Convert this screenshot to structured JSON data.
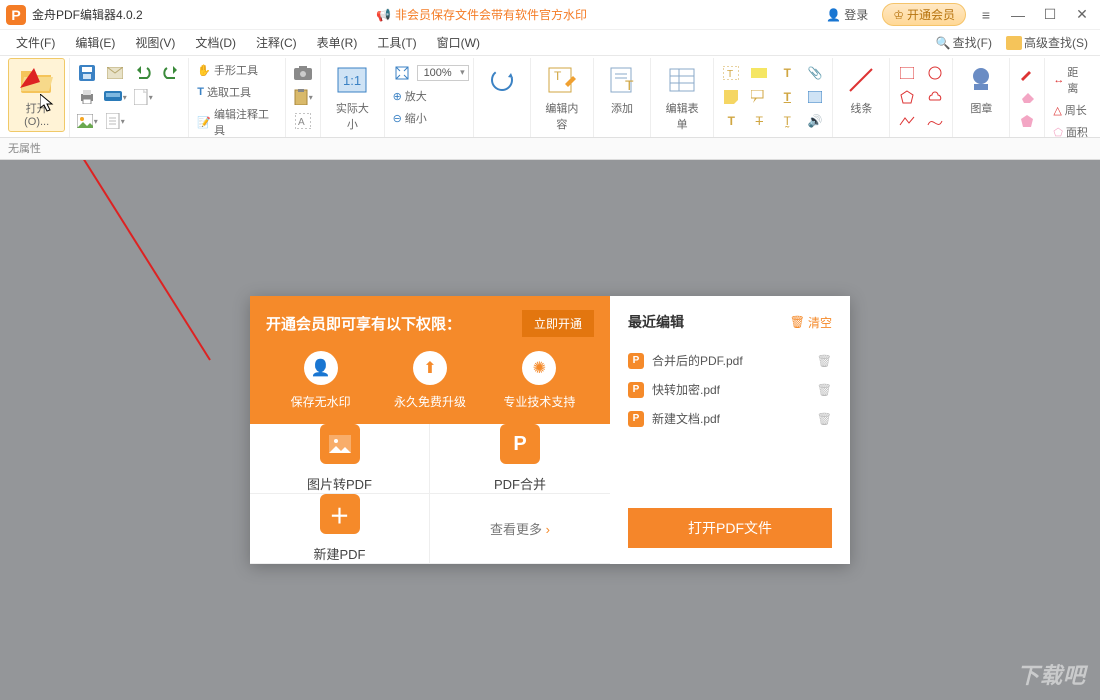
{
  "titlebar": {
    "app_title": "金舟PDF编辑器4.0.2",
    "notice": "非会员保存文件会带有软件官方水印",
    "login": "登录",
    "vip": "开通会员"
  },
  "menubar": {
    "items": [
      "文件(F)",
      "编辑(E)",
      "视图(V)",
      "文档(D)",
      "注释(C)",
      "表单(R)",
      "工具(T)",
      "窗口(W)"
    ],
    "find": "查找(F)",
    "adv_find": "高级查找(S)"
  },
  "toolbar": {
    "open": "打开(O)...",
    "hand_tool": "手形工具",
    "select_tool": "选取工具",
    "annotate_tool": "编辑注释工具",
    "actual_size": "实际大小",
    "zoom_value": "100%",
    "zoom_in": "放大",
    "zoom_out": "缩小",
    "edit_content": "编辑内容",
    "add": "添加",
    "edit_form": "编辑表单",
    "line": "线条",
    "stamp": "图章",
    "distance": "距离",
    "perimeter": "周长",
    "area": "面积"
  },
  "propbar": {
    "text": "无属性"
  },
  "start": {
    "banner_title": "开通会员即可享有以下权限：",
    "open_vip": "立即开通",
    "features": [
      "保存无水印",
      "永久免费升级",
      "专业技术支持"
    ],
    "tiles": {
      "img2pdf": "图片转PDF",
      "merge": "PDF合并",
      "newpdf": "新建PDF",
      "more": "查看更多"
    },
    "recent_title": "最近编辑",
    "clear": "清空",
    "files": [
      "合并后的PDF.pdf",
      "快转加密.pdf",
      "新建文档.pdf"
    ],
    "open_btn": "打开PDF文件"
  },
  "watermark": "下载吧"
}
